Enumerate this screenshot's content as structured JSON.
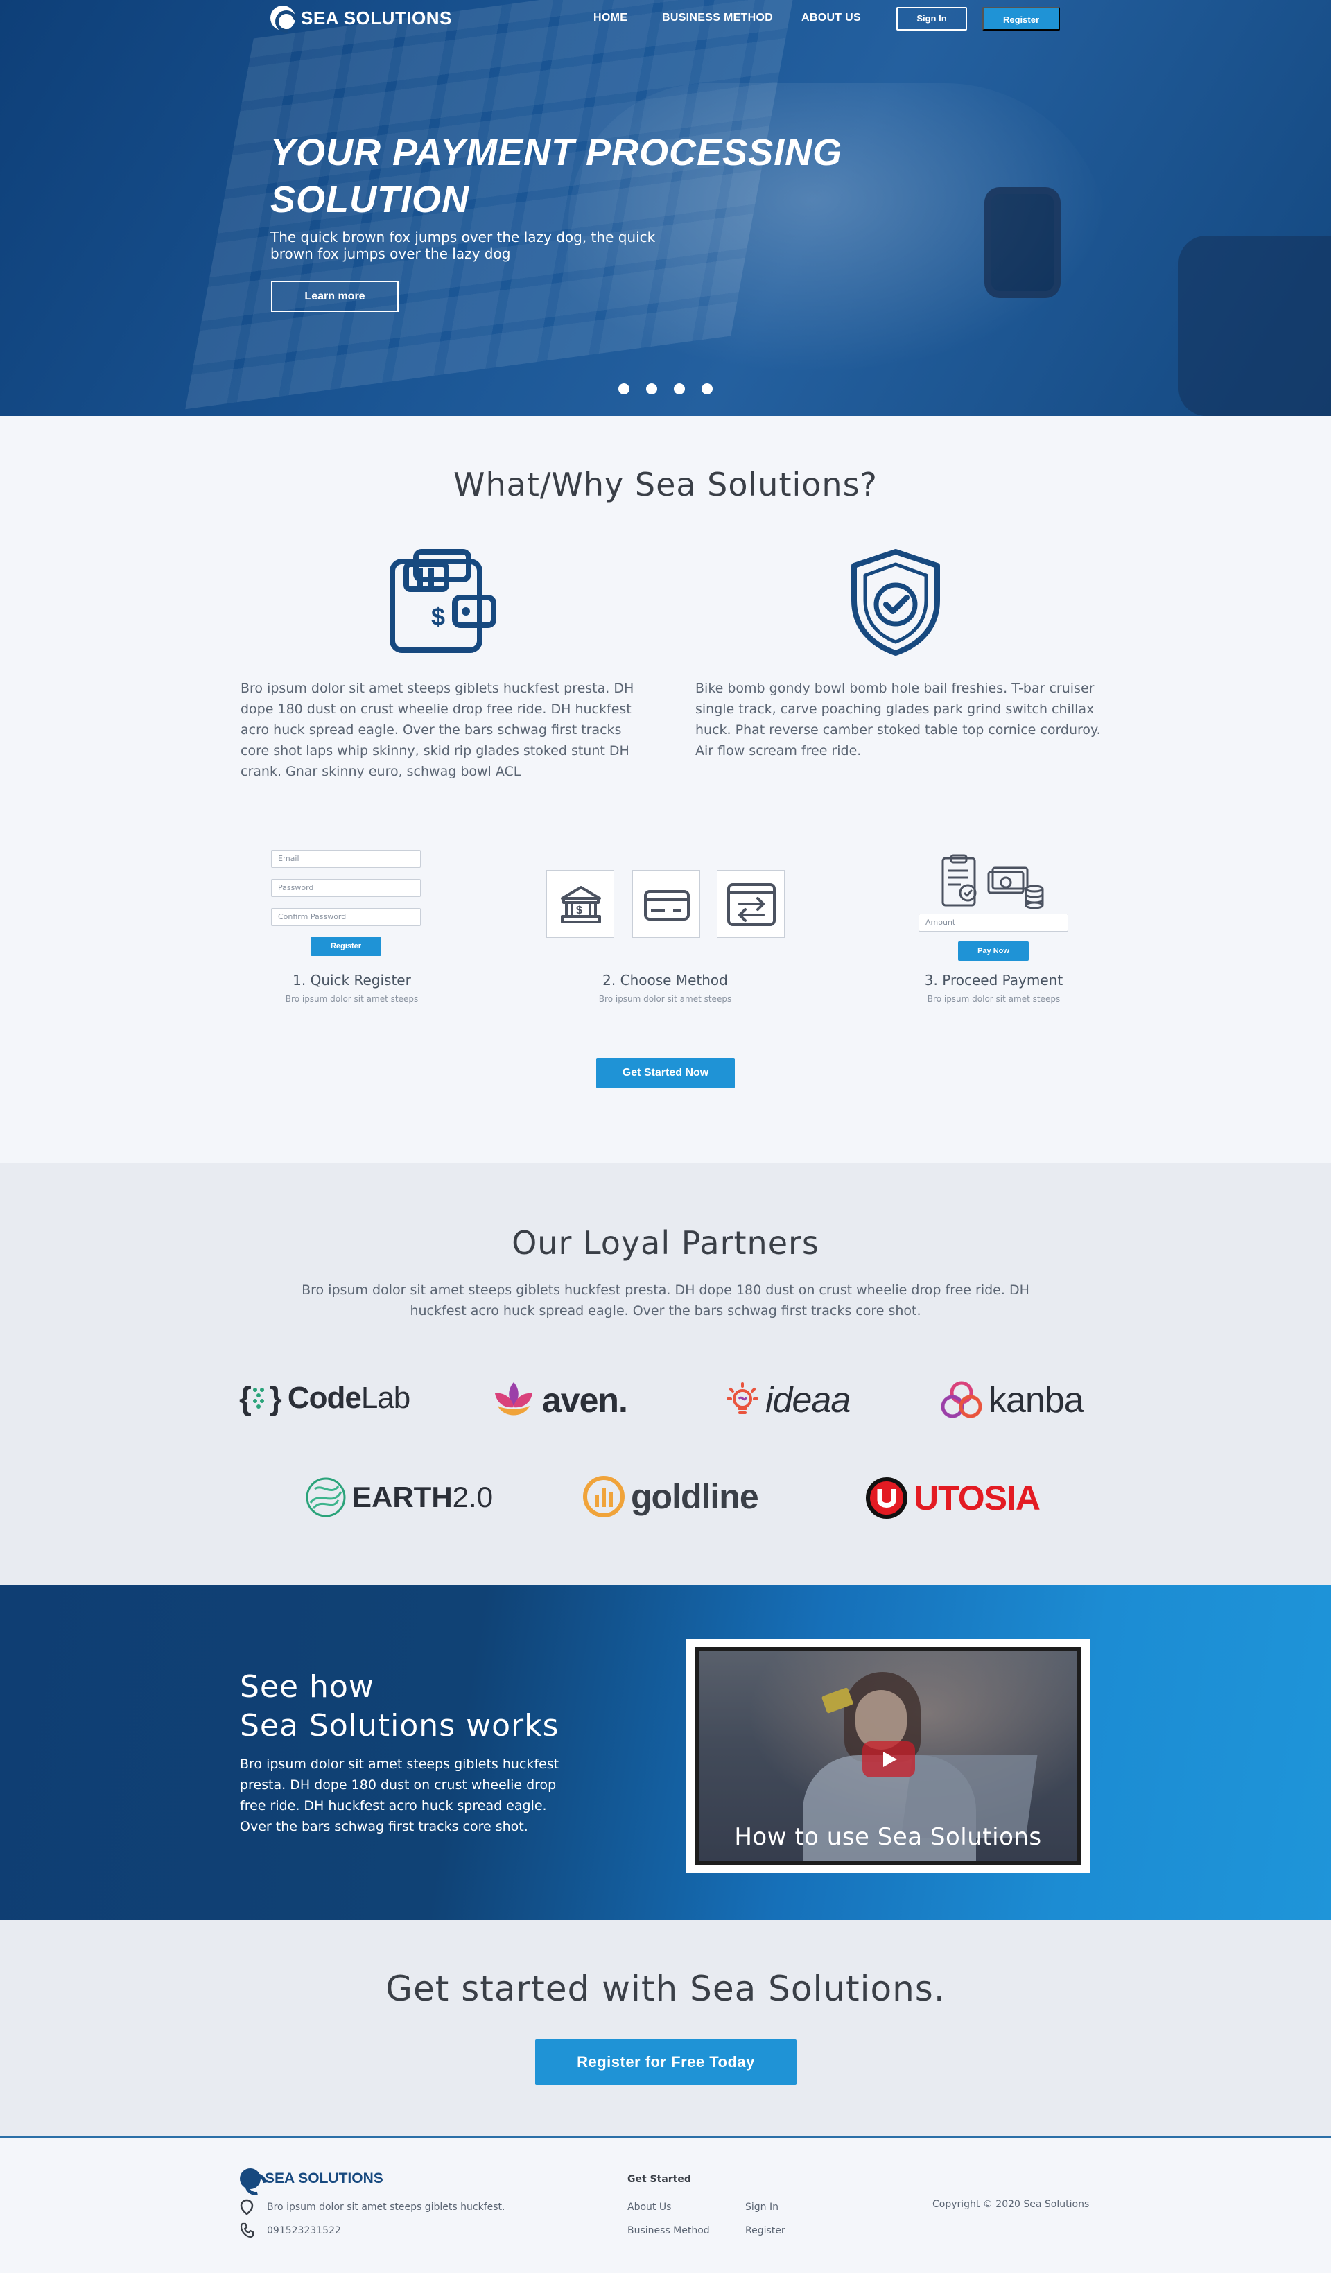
{
  "colors": {
    "primary": "#1f93d6",
    "dark": "#104275",
    "text": "#4a5563"
  },
  "header": {
    "brand": "SEA SOLUTIONS",
    "nav": [
      "HOME",
      "BUSINESS METHOD",
      "ABOUT US"
    ],
    "signin": "Sign In",
    "register": "Register"
  },
  "hero": {
    "title_line1": "YOUR PAYMENT PROCESSING",
    "title_line2": "SOLUTION",
    "subtitle": "The quick brown fox jumps over the lazy dog, the quick brown fox jumps over the lazy dog",
    "cta": "Learn more",
    "slides": 4
  },
  "why": {
    "title": "What/Why Sea Solutions?",
    "left_text": "Bro ipsum dolor sit amet steeps giblets huckfest presta. DH dope 180 dust on crust wheelie drop free ride. DH huckfest acro huck spread eagle. Over the bars schwag first tracks core shot laps whip skinny, skid rip glades stoked stunt DH crank. Gnar skinny euro, schwag bowl ACL",
    "right_text": "Bike bomb gondy bowl bomb hole bail freshies. T-bar cruiser single track, carve poaching glades park grind switch chillax huck. Phat reverse camber stoked table top cornice corduroy. Air flow scream free ride.",
    "left_icon": "wallet-icon",
    "right_icon": "shield-check-icon"
  },
  "steps": {
    "register_form": {
      "email": "Email",
      "password": "Password",
      "confirm": "Confirm Password",
      "button": "Register"
    },
    "pay_form": {
      "amount": "Amount",
      "button": "Pay Now"
    },
    "items": [
      {
        "title": "1. Quick Register",
        "sub": "Bro ipsum dolor sit amet steeps"
      },
      {
        "title": "2. Choose Method",
        "sub": "Bro ipsum dolor sit amet steeps"
      },
      {
        "title": "3. Proceed Payment",
        "sub": "Bro ipsum dolor sit amet steeps"
      }
    ],
    "methods": [
      "bank-icon",
      "card-icon",
      "transfer-icon"
    ],
    "cta": "Get Started Now"
  },
  "partners": {
    "title": "Our Loyal Partners",
    "text": "Bro ipsum dolor sit amet steeps giblets huckfest presta. DH dope 180 dust on crust wheelie drop free ride. DH huckfest acro huck spread eagle. Over the bars schwag first tracks core shot.",
    "logos": {
      "codelab_a": "Code",
      "codelab_b": "Lab",
      "aven": "aven.",
      "ideaa": "ideaa",
      "kanba": "kanba",
      "earth_a": "EARTH",
      "earth_b": "2.0",
      "goldline": "goldline",
      "utosia": "UTOSIA"
    }
  },
  "video": {
    "title_line1": "See how",
    "title_line2": "Sea Solutions works",
    "text": "Bro ipsum dolor sit amet steeps giblets huckfest presta. DH dope 180 dust on crust wheelie drop free ride. DH huckfest acro huck spread eagle. Over the bars schwag first tracks core shot.",
    "caption": "How to use Sea Solutions"
  },
  "get_started": {
    "title": "Get started with Sea Solutions.",
    "cta": "Register for Free Today"
  },
  "footer": {
    "brand": "SEA SOLUTIONS",
    "address": "Bro ipsum dolor sit amet steeps giblets huckfest.",
    "phone": "091523231522",
    "col_title": "Get Started",
    "links": [
      "About Us",
      "Business Method",
      "Sign In",
      "Register"
    ],
    "copyright": "Copyright © 2020 Sea Solutions"
  }
}
